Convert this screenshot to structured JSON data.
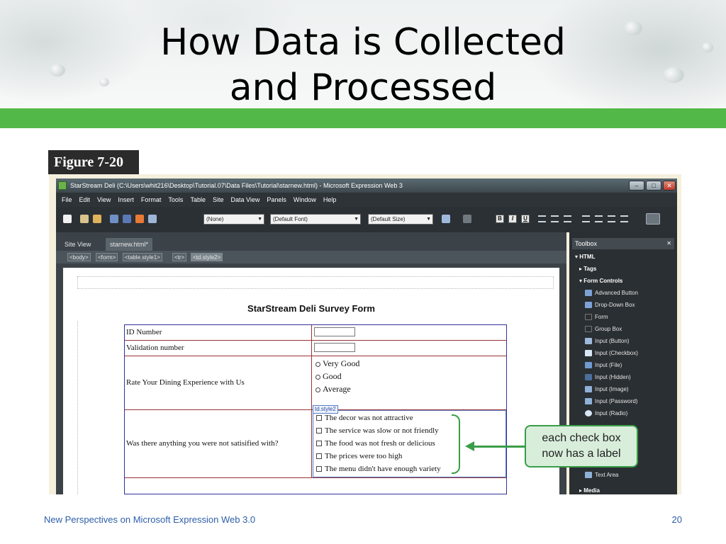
{
  "slide": {
    "title_line1": "How Data is Collected",
    "title_line2": "and Processed",
    "figure_label": "Figure 7-20",
    "footer_left": "New Perspectives on Microsoft Expression Web 3.0",
    "page_number": "20"
  },
  "window": {
    "title": "StarStream Deli (C:\\Users\\whit216\\Desktop\\Tutorial.07\\Data Files\\Tutorial\\starnew.html) - Microsoft Expression Web 3",
    "minimize": "–",
    "maximize": "□",
    "close": "✕"
  },
  "menu": [
    "File",
    "Edit",
    "View",
    "Insert",
    "Format",
    "Tools",
    "Table",
    "Site",
    "Data View",
    "Panels",
    "Window",
    "Help"
  ],
  "toolbar": {
    "style_combo": "(None)",
    "font_combo": "(Default Font)",
    "size_combo": "(Default Size)",
    "bold": "B",
    "italic": "I",
    "underline": "U"
  },
  "tabs": [
    "Site View",
    "starnew.html*"
  ],
  "tag_selector": [
    "<body>",
    "<form>",
    "<table.style1>",
    "<tr>",
    "<td.style2>"
  ],
  "form": {
    "title": "StarStream Deli Survey Form",
    "rows": [
      {
        "label": "ID Number"
      },
      {
        "label": "Validation number"
      },
      {
        "label": "Rate Your Dining Experience with Us",
        "radios": [
          "Very Good",
          "Good",
          "Average"
        ]
      },
      {
        "label": "Was there anything you were not satisified with?",
        "checks": [
          "The decor was not attractive",
          "The service was slow or not friendly",
          "The food was not fresh or delicious",
          "The prices were too high",
          "The menu didn't have enough variety"
        ]
      }
    ],
    "td_tag": "td.style2"
  },
  "toolbox": {
    "title": "Toolbox",
    "items": [
      {
        "label": "HTML",
        "header": true,
        "color": ""
      },
      {
        "label": "Tags",
        "header": true,
        "color": ""
      },
      {
        "label": "Form Controls",
        "header": true,
        "color": ""
      },
      {
        "label": "Advanced Button",
        "header": false,
        "color": "#7da3d6"
      },
      {
        "label": "Drop-Down Box",
        "header": false,
        "color": "#7da3d6"
      },
      {
        "label": "Form",
        "header": false,
        "color": "#555b60"
      },
      {
        "label": "Group Box",
        "header": false,
        "color": "#555b60"
      },
      {
        "label": "Input (Button)",
        "header": false,
        "color": "#9fb9dc"
      },
      {
        "label": "Input (Checkbox)",
        "header": false,
        "color": "#d8e6f6"
      },
      {
        "label": "Input (File)",
        "header": false,
        "color": "#6e9bd1"
      },
      {
        "label": "Input (Hidden)",
        "header": false,
        "color": "#4a6f9c"
      },
      {
        "label": "Input (Image)",
        "header": false,
        "color": "#8fb1d8"
      },
      {
        "label": "Input (Password)",
        "header": false,
        "color": "#8fb1d8"
      },
      {
        "label": "Input (Radio)",
        "header": false,
        "color": "#d8e6f6"
      }
    ],
    "lower_items": [
      {
        "label": "Text Area",
        "color": "#8fb1d8"
      },
      {
        "label": "Media",
        "color": ""
      }
    ]
  },
  "callout": {
    "line1": "each check box",
    "line2": "now has a label"
  }
}
